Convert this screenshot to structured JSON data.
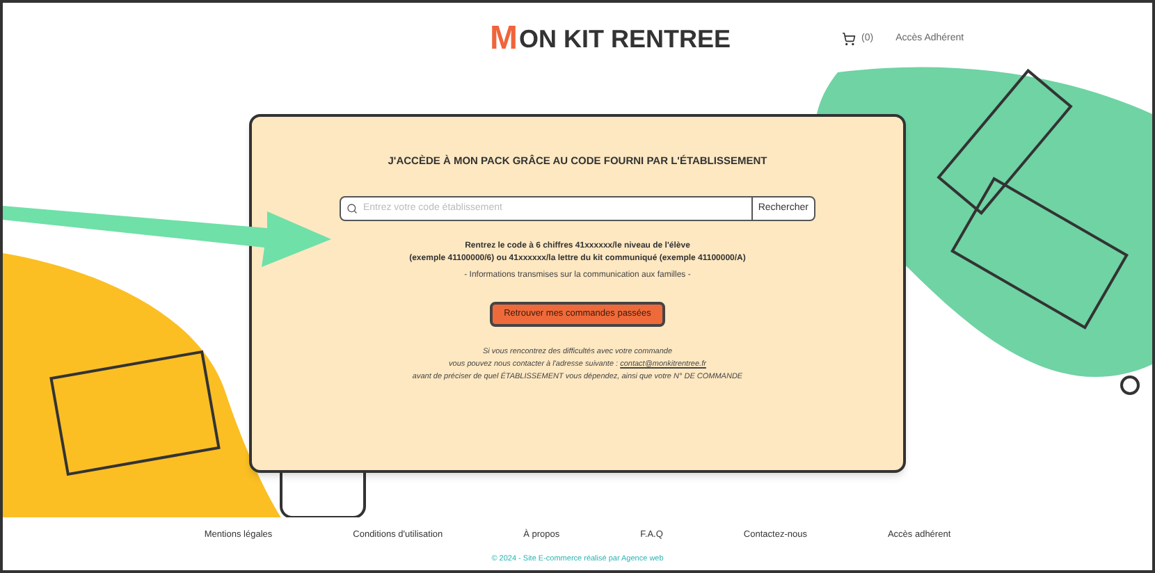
{
  "header": {
    "logo": "MON KIT RENTREE",
    "cart_count": "(0)",
    "member_link": "Accès Adhérent"
  },
  "card": {
    "title": "J'ACCÈDE À MON PACK GRÂCE AU CODE FOURNI PAR L'ÉTABLISSEMENT",
    "search": {
      "placeholder": "Entrez votre code établissement",
      "button": "Rechercher"
    },
    "instructions": [
      "Rentrez le code à 6 chiffres 41xxxxxx/le niveau de l'élève",
      "(exemple 41100000/6) ou 41xxxxxx/la lettre du kit communiqué (exemple 41100000/A)"
    ],
    "note": "- Informations transmises sur la communication aux familles -",
    "orders_button": "Retrouver mes commandes passées",
    "help": [
      "Si vous rencontrez des difficultés avec votre commande",
      "vous pouvez nous contacter à l'adresse suivante : ",
      "avant de préciser de quel ÉTABLISSEMENT vous dépendez, ainsi que votre N° DE COMMANDE"
    ],
    "help_email": "contact@monkitrentree.fr"
  },
  "footer": {
    "links": [
      "Mentions légales",
      "Conditions d'utilisation",
      "À propos",
      "F.A.Q",
      "Contactez-nous",
      "Accès adhérent"
    ],
    "copyright": "© 2024 - Site E-commerce réalisé par Agence web"
  }
}
